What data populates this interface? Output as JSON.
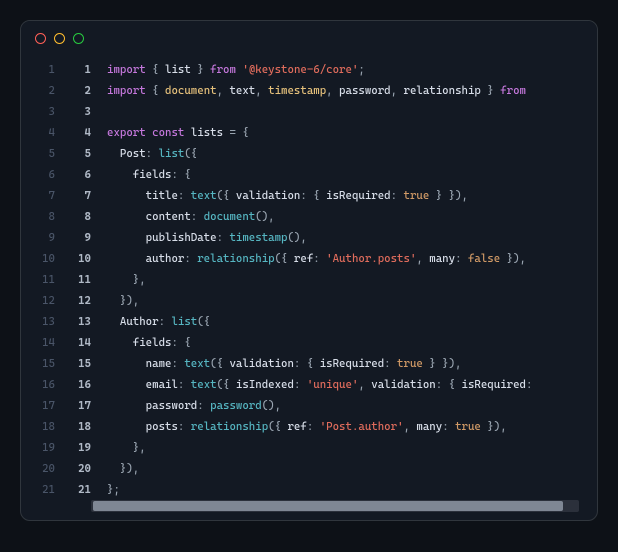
{
  "outerLineCount": 21,
  "innerLineCount": 21,
  "code": {
    "lines": [
      [
        [
          "kw",
          "import"
        ],
        [
          "punct",
          " { "
        ],
        [
          "id",
          "list"
        ],
        [
          "punct",
          " } "
        ],
        [
          "kw",
          "from"
        ],
        [
          "punct",
          " "
        ],
        [
          "str",
          "'@keystone-6/core'"
        ],
        [
          "punct",
          ";"
        ]
      ],
      [
        [
          "kw",
          "import"
        ],
        [
          "punct",
          " { "
        ],
        [
          "obj",
          "document"
        ],
        [
          "punct",
          ", "
        ],
        [
          "id",
          "text"
        ],
        [
          "punct",
          ", "
        ],
        [
          "obj",
          "timestamp"
        ],
        [
          "punct",
          ", "
        ],
        [
          "id",
          "password"
        ],
        [
          "punct",
          ", "
        ],
        [
          "id",
          "relationship"
        ],
        [
          "punct",
          " } "
        ],
        [
          "kw",
          "from"
        ]
      ],
      [],
      [
        [
          "kw",
          "export"
        ],
        [
          "punct",
          " "
        ],
        [
          "kw",
          "const"
        ],
        [
          "punct",
          " "
        ],
        [
          "id",
          "lists"
        ],
        [
          "punct",
          " = {"
        ]
      ],
      [
        [
          "punct",
          "  "
        ],
        [
          "prop",
          "Post"
        ],
        [
          "punct",
          ": "
        ],
        [
          "fn",
          "list"
        ],
        [
          "punct",
          "({"
        ]
      ],
      [
        [
          "punct",
          "    "
        ],
        [
          "prop",
          "fields"
        ],
        [
          "punct",
          ": {"
        ]
      ],
      [
        [
          "punct",
          "      "
        ],
        [
          "prop",
          "title"
        ],
        [
          "punct",
          ": "
        ],
        [
          "fn",
          "text"
        ],
        [
          "punct",
          "({ "
        ],
        [
          "prop",
          "validation"
        ],
        [
          "punct",
          ": { "
        ],
        [
          "prop",
          "isRequired"
        ],
        [
          "punct",
          ": "
        ],
        [
          "bool",
          "true"
        ],
        [
          "punct",
          " } }),"
        ]
      ],
      [
        [
          "punct",
          "      "
        ],
        [
          "prop",
          "content"
        ],
        [
          "punct",
          ": "
        ],
        [
          "fn",
          "document"
        ],
        [
          "punct",
          "(),"
        ]
      ],
      [
        [
          "punct",
          "      "
        ],
        [
          "prop",
          "publishDate"
        ],
        [
          "punct",
          ": "
        ],
        [
          "fn",
          "timestamp"
        ],
        [
          "punct",
          "(),"
        ]
      ],
      [
        [
          "punct",
          "      "
        ],
        [
          "prop",
          "author"
        ],
        [
          "punct",
          ": "
        ],
        [
          "fn",
          "relationship"
        ],
        [
          "punct",
          "({ "
        ],
        [
          "prop",
          "ref"
        ],
        [
          "punct",
          ": "
        ],
        [
          "str",
          "'Author.posts'"
        ],
        [
          "punct",
          ", "
        ],
        [
          "prop",
          "many"
        ],
        [
          "punct",
          ": "
        ],
        [
          "bool",
          "false"
        ],
        [
          "punct",
          " }),"
        ]
      ],
      [
        [
          "punct",
          "    },"
        ]
      ],
      [
        [
          "punct",
          "  }),"
        ]
      ],
      [
        [
          "punct",
          "  "
        ],
        [
          "prop",
          "Author"
        ],
        [
          "punct",
          ": "
        ],
        [
          "fn",
          "list"
        ],
        [
          "punct",
          "({"
        ]
      ],
      [
        [
          "punct",
          "    "
        ],
        [
          "prop",
          "fields"
        ],
        [
          "punct",
          ": {"
        ]
      ],
      [
        [
          "punct",
          "      "
        ],
        [
          "prop",
          "name"
        ],
        [
          "punct",
          ": "
        ],
        [
          "fn",
          "text"
        ],
        [
          "punct",
          "({ "
        ],
        [
          "prop",
          "validation"
        ],
        [
          "punct",
          ": { "
        ],
        [
          "prop",
          "isRequired"
        ],
        [
          "punct",
          ": "
        ],
        [
          "bool",
          "true"
        ],
        [
          "punct",
          " } }),"
        ]
      ],
      [
        [
          "punct",
          "      "
        ],
        [
          "prop",
          "email"
        ],
        [
          "punct",
          ": "
        ],
        [
          "fn",
          "text"
        ],
        [
          "punct",
          "({ "
        ],
        [
          "prop",
          "isIndexed"
        ],
        [
          "punct",
          ": "
        ],
        [
          "str",
          "'unique'"
        ],
        [
          "punct",
          ", "
        ],
        [
          "prop",
          "validation"
        ],
        [
          "punct",
          ": { "
        ],
        [
          "prop",
          "isRequired"
        ],
        [
          "punct",
          ":"
        ]
      ],
      [
        [
          "punct",
          "      "
        ],
        [
          "prop",
          "password"
        ],
        [
          "punct",
          ": "
        ],
        [
          "fn",
          "password"
        ],
        [
          "punct",
          "(),"
        ]
      ],
      [
        [
          "punct",
          "      "
        ],
        [
          "prop",
          "posts"
        ],
        [
          "punct",
          ": "
        ],
        [
          "fn",
          "relationship"
        ],
        [
          "punct",
          "({ "
        ],
        [
          "prop",
          "ref"
        ],
        [
          "punct",
          ": "
        ],
        [
          "str",
          "'Post.author'"
        ],
        [
          "punct",
          ", "
        ],
        [
          "prop",
          "many"
        ],
        [
          "punct",
          ": "
        ],
        [
          "bool",
          "true"
        ],
        [
          "punct",
          " }),"
        ]
      ],
      [
        [
          "punct",
          "    },"
        ]
      ],
      [
        [
          "punct",
          "  }),"
        ]
      ],
      [
        [
          "punct",
          "};"
        ]
      ]
    ]
  }
}
